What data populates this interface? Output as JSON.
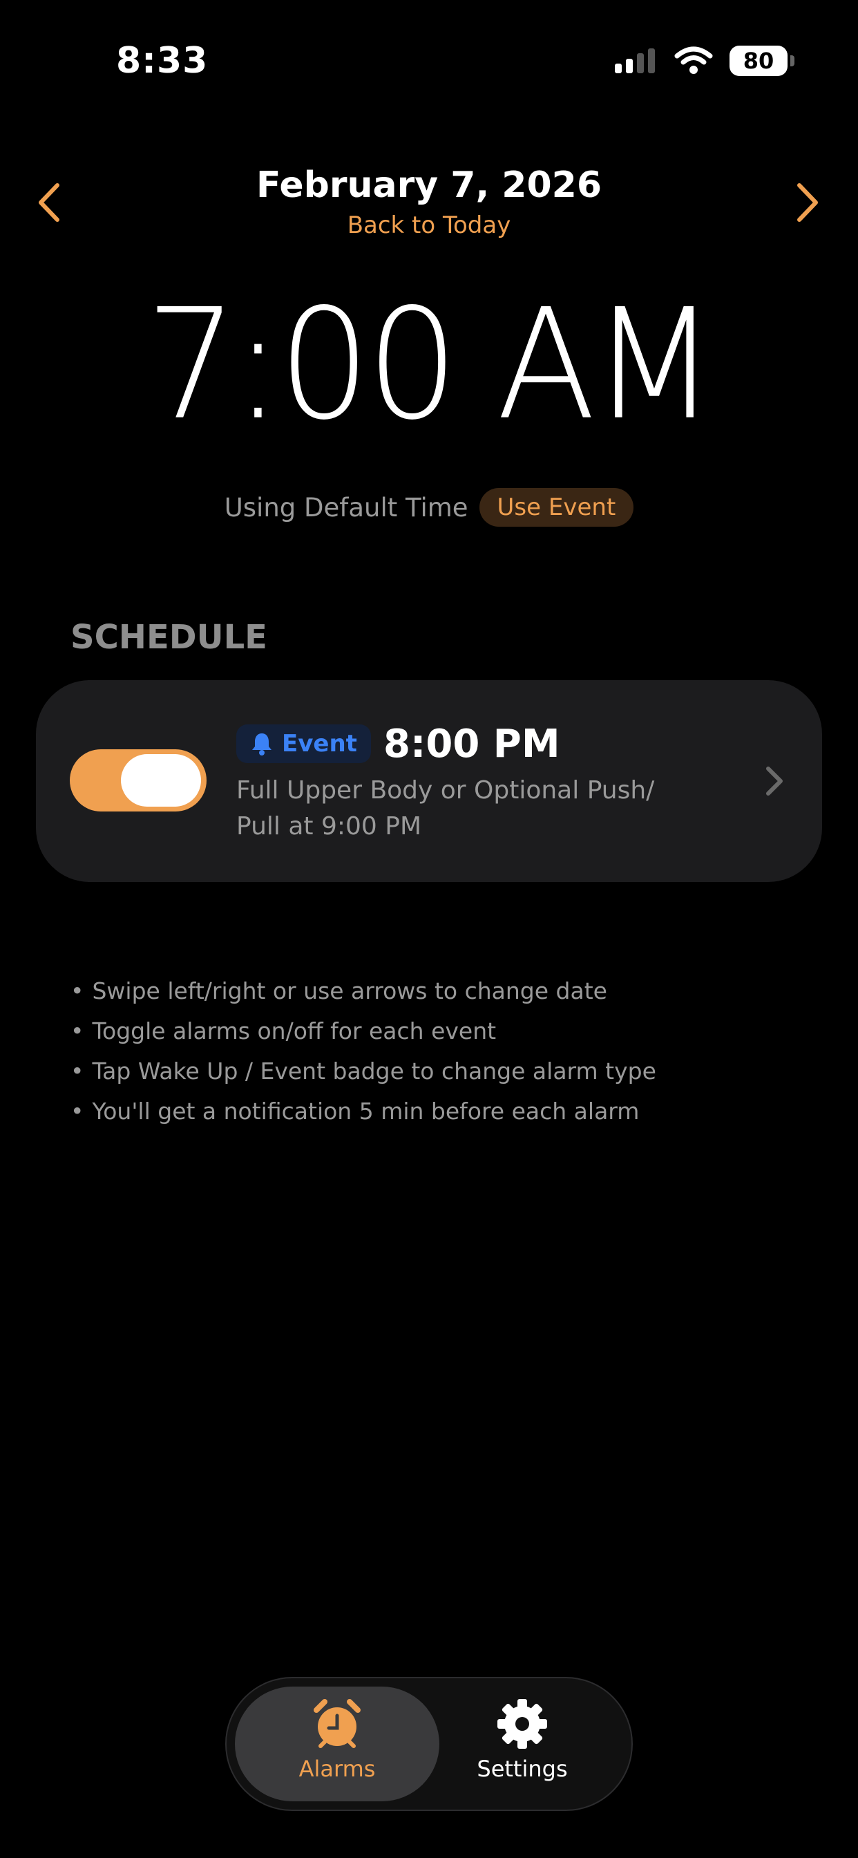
{
  "status_bar": {
    "time": "8:33",
    "battery": "80"
  },
  "header": {
    "date": "February 7, 2026",
    "back_to_today": "Back to Today"
  },
  "alarm": {
    "time": "7:00",
    "period": "AM",
    "default_note": "Using Default Time",
    "use_event_label": "Use Event"
  },
  "schedule": {
    "section_title": "SCHEDULE",
    "items": [
      {
        "enabled": true,
        "badge": "Event",
        "time": "8:00 PM",
        "description": "Full Upper Body or Optional Push/ Pull at 9:00 PM"
      }
    ]
  },
  "tips": [
    "Swipe left/right or use arrows to change date",
    "Toggle alarms on/off for each event",
    "Tap Wake Up / Event badge to change alarm type",
    "You'll get a notification 5 min before each alarm"
  ],
  "tabbar": {
    "tabs": [
      {
        "label": "Alarms",
        "icon": "alarm-clock-icon",
        "active": true
      },
      {
        "label": "Settings",
        "icon": "gear-icon",
        "active": false
      }
    ]
  },
  "colors": {
    "accent": "#f0a050",
    "event_blue": "#3b82f6",
    "card_bg": "#1c1c1e",
    "background": "#000000"
  }
}
